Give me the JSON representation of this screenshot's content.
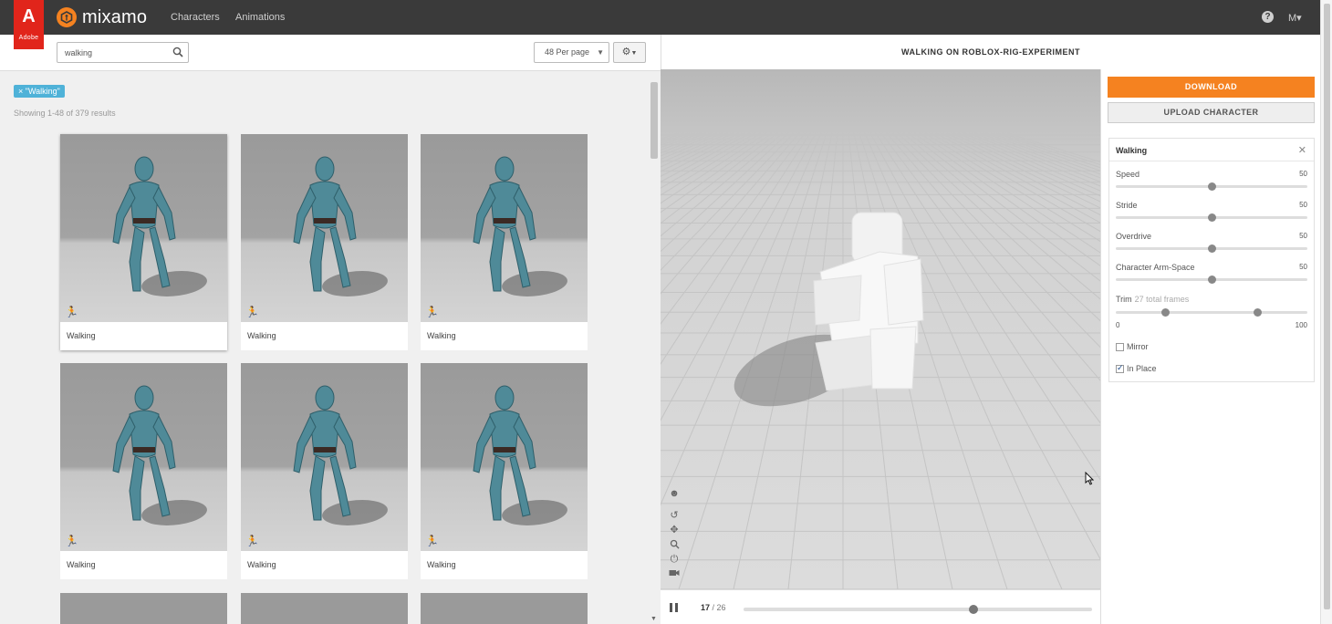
{
  "adobe": {
    "mark": "A",
    "text": "Adobe"
  },
  "brand": {
    "name": "mixamo"
  },
  "nav": {
    "characters": "Characters",
    "animations": "Animations"
  },
  "user": {
    "menu_label": "M▾"
  },
  "search": {
    "value": "walking",
    "per_page": "48 Per page"
  },
  "filter": {
    "tag": "× \"Walking\"",
    "result_count": "Showing 1-48 of 379 results"
  },
  "cards": [
    {
      "label": "Walking"
    },
    {
      "label": "Walking"
    },
    {
      "label": "Walking"
    },
    {
      "label": "Walking"
    },
    {
      "label": "Walking"
    },
    {
      "label": "Walking"
    }
  ],
  "viewer": {
    "title": "WALKING ON ROBLOX-RIG-EXPERIMENT"
  },
  "timeline": {
    "current_frame": "17",
    "total_frames": " / 26",
    "progress": 0.66
  },
  "actions": {
    "download": "DOWNLOAD",
    "upload": "UPLOAD CHARACTER"
  },
  "animation": {
    "title": "Walking",
    "params": [
      {
        "label": "Speed",
        "value": "50",
        "fraction": 0.5
      },
      {
        "label": "Stride",
        "value": "50",
        "fraction": 0.5
      },
      {
        "label": "Overdrive",
        "value": "50",
        "fraction": 0.5
      },
      {
        "label": "Character Arm-Space",
        "value": "50",
        "fraction": 0.5
      }
    ],
    "trim": {
      "label": "Trim",
      "sub": "27 total frames",
      "min": "0",
      "max": "100",
      "start": 0.26,
      "end": 0.74
    },
    "mirror": {
      "label": "Mirror",
      "checked": false
    },
    "in_place": {
      "label": "In Place",
      "checked": true
    }
  },
  "colors": {
    "accent": "#f58220",
    "tag": "#4fb2d8",
    "adobe_red": "#e1251b"
  }
}
